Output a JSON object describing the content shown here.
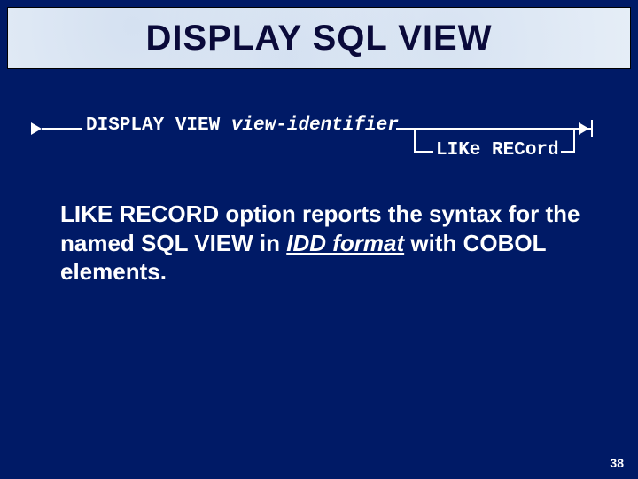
{
  "title": "DISPLAY SQL VIEW",
  "syntax": {
    "lead": "DISPLAY VIEW ",
    "identifier": "view-identifier",
    "option": "LIKe RECord"
  },
  "body": {
    "part1": " LIKE RECORD option reports the syntax for the named SQL VIEW in ",
    "idd": "IDD format",
    "part2": " with COBOL elements."
  },
  "pageNumber": "38"
}
